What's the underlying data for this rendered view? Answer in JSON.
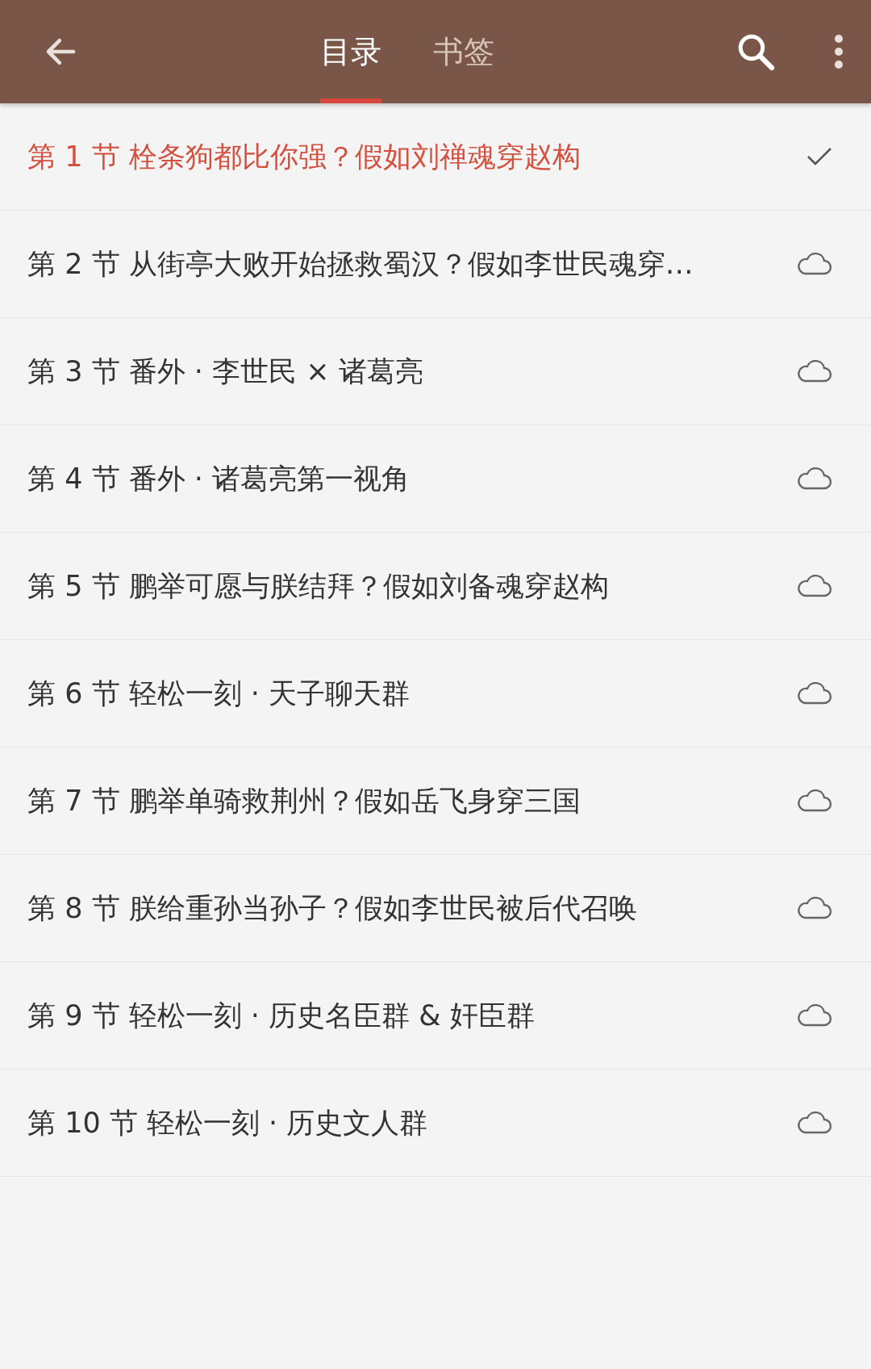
{
  "toolbar": {
    "tabs": [
      {
        "label": "目录",
        "selected": true
      },
      {
        "label": "书签",
        "selected": false
      }
    ]
  },
  "chapters": [
    {
      "title": "第 1 节 栓条狗都比你强？假如刘禅魂穿赵构",
      "selected": true
    },
    {
      "title": "第 2 节 从街亭大败开始拯救蜀汉？假如李世民魂穿…",
      "selected": false
    },
    {
      "title": "第 3 节 番外 · 李世民 × 诸葛亮",
      "selected": false
    },
    {
      "title": "第 4 节 番外 · 诸葛亮第一视角",
      "selected": false
    },
    {
      "title": "第 5 节 鹏举可愿与朕结拜？假如刘备魂穿赵构",
      "selected": false
    },
    {
      "title": "第 6 节 轻松一刻 · 天子聊天群",
      "selected": false
    },
    {
      "title": "第 7 节 鹏举单骑救荆州？假如岳飞身穿三国",
      "selected": false
    },
    {
      "title": "第 8 节 朕给重孙当孙子？假如李世民被后代召唤",
      "selected": false
    },
    {
      "title": "第 9 节 轻松一刻 · 历史名臣群 & 奸臣群",
      "selected": false
    },
    {
      "title": "第 10 节 轻松一刻 · 历史文人群",
      "selected": false
    }
  ]
}
